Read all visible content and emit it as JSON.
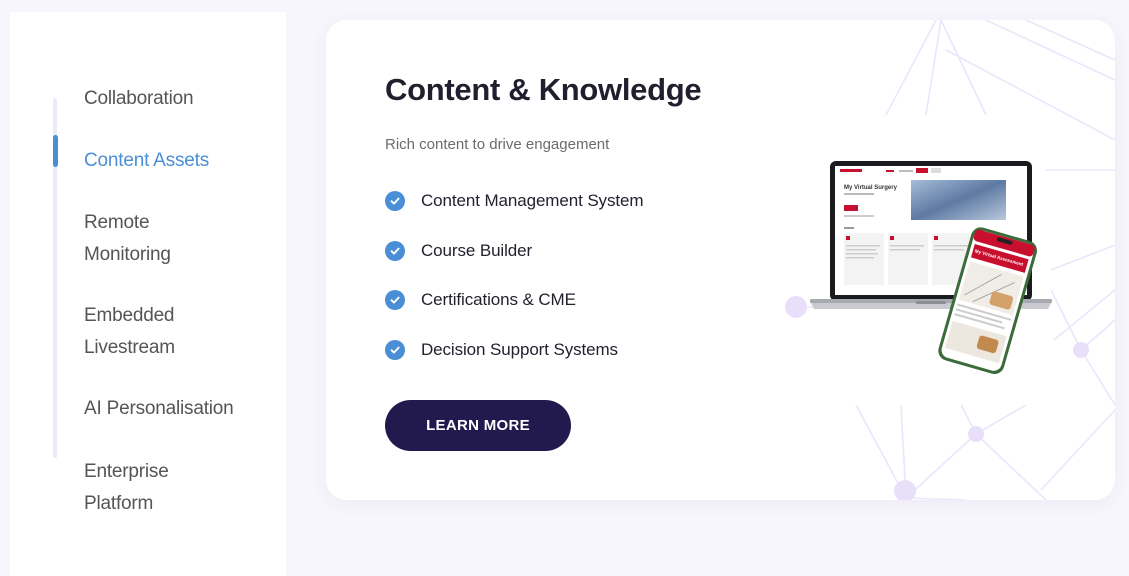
{
  "sidebar": {
    "items": [
      {
        "label": "Collaboration",
        "active": false
      },
      {
        "label": "Content Assets",
        "active": true
      },
      {
        "label": "Remote Monitoring",
        "active": false
      },
      {
        "label": "Embedded Livestream",
        "active": false
      },
      {
        "label": "AI Personalisation",
        "active": false
      },
      {
        "label": "Enterprise Platform",
        "active": false
      }
    ]
  },
  "main": {
    "title": "Content & Knowledge",
    "subtitle": "Rich content to drive engagement",
    "features": [
      "Content Management System",
      "Course Builder",
      "Certifications & CME",
      "Decision Support Systems"
    ],
    "cta_label": "LEARN MORE"
  },
  "preview": {
    "laptop_heading": "My Virtual Surgery",
    "phone_heading": "My Virtual Assessment"
  },
  "colors": {
    "accent": "#4a8fd6",
    "button": "#221a4f",
    "network": "#e8e0fb"
  }
}
